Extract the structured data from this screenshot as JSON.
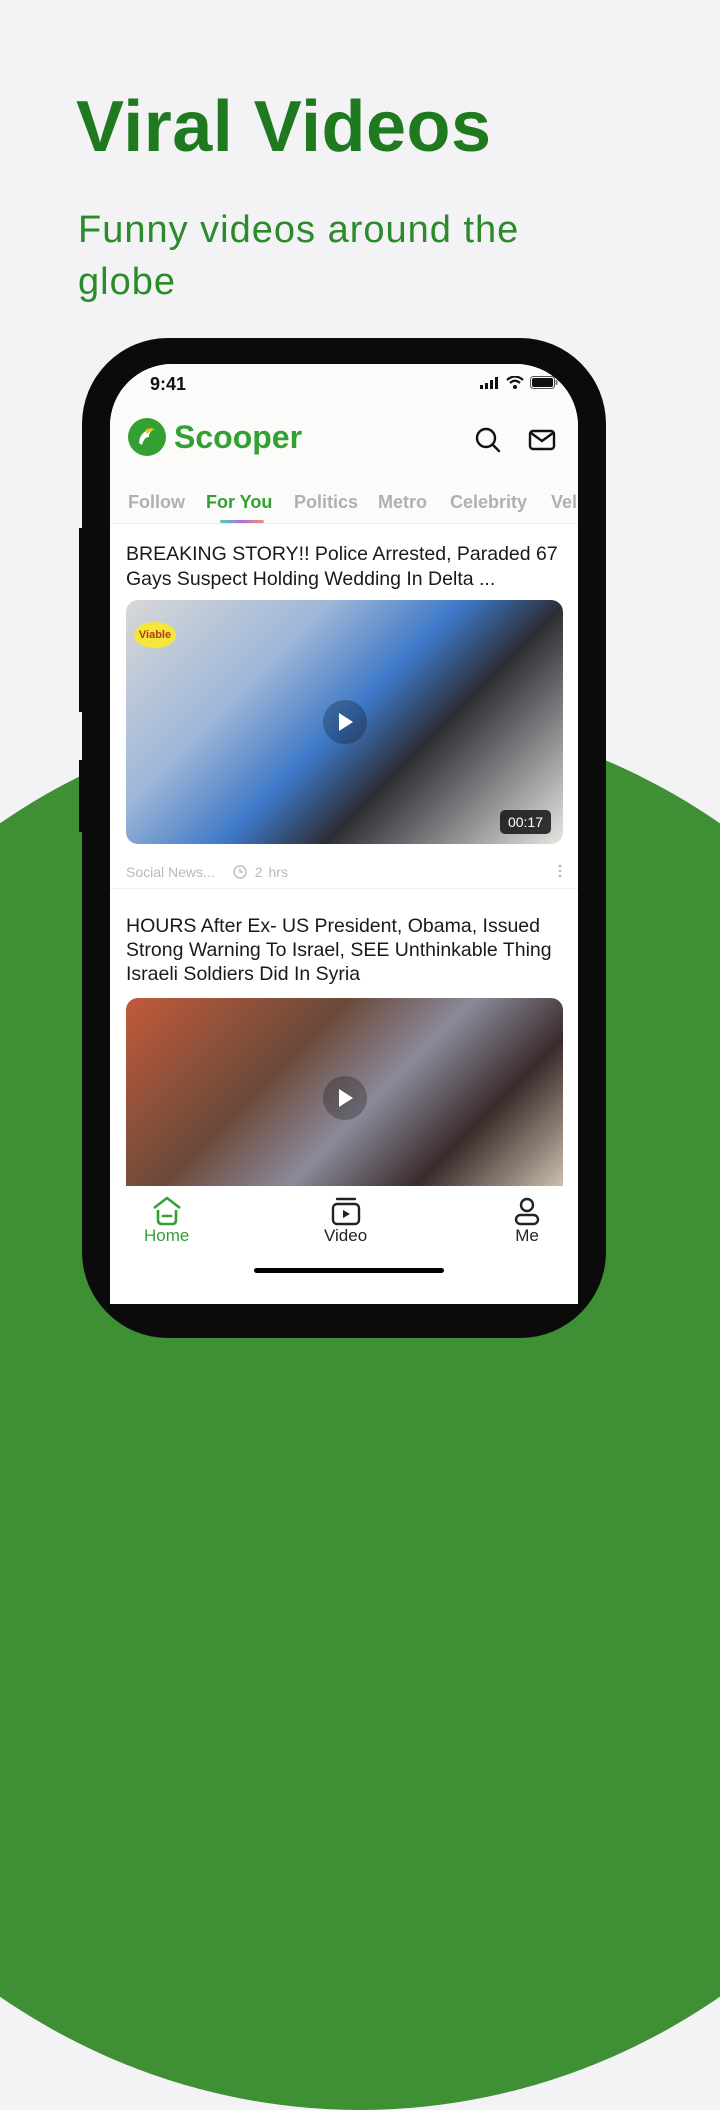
{
  "promo": {
    "title": "Viral Videos",
    "subtitle": "Funny videos around the globe"
  },
  "status_bar": {
    "time": "9:41"
  },
  "app": {
    "name": "Scooper",
    "brand_color": "#34a034",
    "header_icons": [
      "search-icon",
      "mail-icon"
    ]
  },
  "tabs": [
    {
      "label": "Follow",
      "active": false
    },
    {
      "label": "For You",
      "active": true
    },
    {
      "label": "Politics",
      "active": false
    },
    {
      "label": "Metro",
      "active": false
    },
    {
      "label": "Celebrity",
      "active": false
    },
    {
      "label": "Vel",
      "active": false
    }
  ],
  "feed": [
    {
      "title": "BREAKING STORY!! Police Arrested, Paraded 67 Gays Suspect Holding Wedding In Delta ...",
      "thumbnail_badge": "Viable",
      "duration": "00:17",
      "source": "Social News...",
      "time_ago": "2",
      "time_unit": "hrs"
    },
    {
      "title": "HOURS After Ex- US President, Obama, Issued Strong Warning To Israel, SEE Unthinkable Thing Israeli Soldiers Did In Syria"
    }
  ],
  "bottom_nav": [
    {
      "label": "Home",
      "icon": "home-icon",
      "active": true
    },
    {
      "label": "Video",
      "icon": "video-icon",
      "active": false
    },
    {
      "label": "Me",
      "icon": "user-icon",
      "active": false
    }
  ]
}
